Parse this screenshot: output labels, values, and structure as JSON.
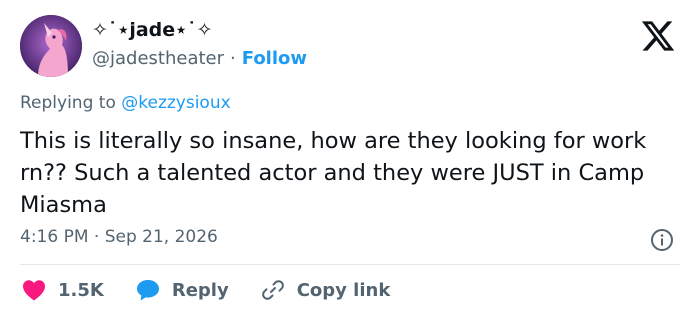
{
  "tweet": {
    "display_name": "✧˙⋆jade⋆˙✧",
    "handle": "@jadestheater",
    "separator": "·",
    "follow_label": "Follow",
    "replying_prefix": "Replying to",
    "replying_to": "@kezzysioux",
    "text": "This is literally so insane, how are they looking for work rn?? Such a talented actor and they were JUST in Camp Miasma",
    "timestamp": "4:16 PM · Sep 21, 2026"
  },
  "actions": {
    "likes_count": "1.5K",
    "reply_label": "Reply",
    "copy_label": "Copy link"
  },
  "icons": {
    "brand": "x-logo-icon",
    "info": "info-icon",
    "like": "heart-icon",
    "reply": "speech-bubble-icon",
    "copy": "link-icon"
  },
  "colors": {
    "accent": "#1d9bf0",
    "like": "#f91880",
    "muted": "#536471",
    "text": "#0f1419"
  }
}
